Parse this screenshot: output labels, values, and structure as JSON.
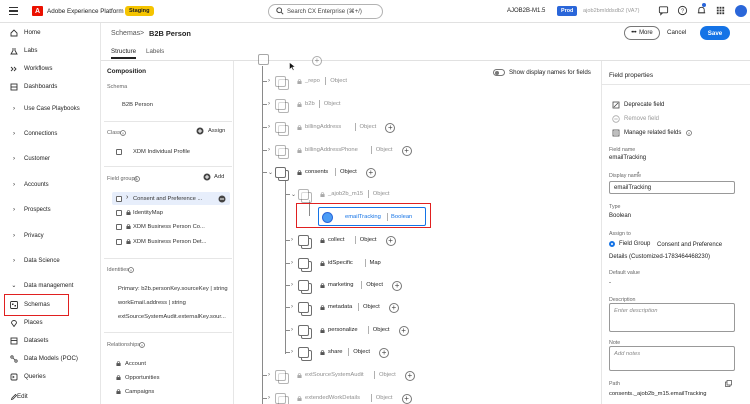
{
  "topbar": {
    "app_name": "Adobe Experience Platform",
    "sandbox_badge": "Staging",
    "search_placeholder": "Search CX Enterprise (⌘+/)",
    "org_name": "AJOB2B-M1.5",
    "env_badge": "Prod",
    "user_label": "ajob2bmlddsdb2 (VA7)"
  },
  "nav": {
    "items": [
      {
        "label": "Home",
        "icon": "home-icon"
      },
      {
        "label": "Labs",
        "icon": "labs-icon"
      },
      {
        "label": "Workflows",
        "icon": "workflows-icon"
      },
      {
        "label": "Dashboards",
        "icon": "dashboards-icon"
      },
      {
        "label": "Use Case Playbooks",
        "icon": "chevron-right-icon"
      },
      {
        "label": "Connections",
        "icon": "chevron-right-icon"
      },
      {
        "label": "Customer",
        "icon": "chevron-right-icon"
      },
      {
        "label": "Accounts",
        "icon": "chevron-right-icon"
      },
      {
        "label": "Prospects",
        "icon": "chevron-right-icon"
      },
      {
        "label": "Privacy",
        "icon": "chevron-right-icon"
      },
      {
        "label": "Data Science",
        "icon": "chevron-right-icon"
      },
      {
        "label": "Data management",
        "icon": "chevron-down-icon"
      },
      {
        "label": "Schemas",
        "icon": "schemas-icon"
      },
      {
        "label": "Places",
        "icon": "places-icon"
      },
      {
        "label": "Datasets",
        "icon": "datasets-icon"
      },
      {
        "label": "Data Models (POC)",
        "icon": "data-models-icon"
      },
      {
        "label": "Queries",
        "icon": "queries-icon"
      }
    ],
    "edit_label": "Edit"
  },
  "header": {
    "breadcrumb_root": "Schemas",
    "breadcrumb_sep": ">",
    "breadcrumb_current": "B2B Person",
    "tabs": [
      {
        "label": "Structure"
      },
      {
        "label": "Labels"
      }
    ],
    "more_label": "More",
    "cancel_label": "Cancel",
    "save_label": "Save"
  },
  "composition": {
    "title": "Composition",
    "schema_label": "Schema",
    "schema_value": "B2B Person",
    "class_label": "Class",
    "assign_label": "Assign",
    "class_value": "XDM Individual Profile",
    "field_groups_label": "Field groups",
    "add_label": "Add",
    "field_groups": [
      {
        "label": "Consent and Preference ..."
      },
      {
        "label": "IdentityMap"
      },
      {
        "label": "XDM Business Person Co..."
      },
      {
        "label": "XDM Business Person Det..."
      }
    ],
    "identities_label": "Identities",
    "identities": [
      {
        "label": "Primary: b2b.personKey.sourceKey | string"
      },
      {
        "label": "workEmail.address | string"
      },
      {
        "label": "extSourceSystemAudit.externalKey.sour..."
      }
    ],
    "relationships_label": "Relationships",
    "relationships": [
      {
        "label": "Account"
      },
      {
        "label": "Opportunities"
      },
      {
        "label": "Campaigns"
      }
    ]
  },
  "canvas": {
    "toggle_label": "Show display names for fields",
    "nodes": [
      {
        "name": "_repo",
        "type": "Object",
        "dim": true
      },
      {
        "name": "b2b",
        "type": "Object",
        "dim": true
      },
      {
        "name": "billingAddress",
        "type": "Object",
        "dim": true
      },
      {
        "name": "billingAddressPhone",
        "type": "Object",
        "dim": true
      },
      {
        "name": "consents",
        "type": "Object",
        "dim": false
      },
      {
        "name": "_ajob2b_m15",
        "type": "Object",
        "dim": true
      },
      {
        "name": "emailTracking",
        "type": "Boolean",
        "dim": false
      },
      {
        "name": "collect",
        "type": "Object",
        "dim": false
      },
      {
        "name": "idSpecific",
        "type": "Map",
        "dim": false
      },
      {
        "name": "marketing",
        "type": "Object",
        "dim": false
      },
      {
        "name": "metadata",
        "type": "Object",
        "dim": false
      },
      {
        "name": "personalize",
        "type": "Object",
        "dim": false
      },
      {
        "name": "share",
        "type": "Object",
        "dim": false
      },
      {
        "name": "extSourceSystemAudit",
        "type": "Object",
        "dim": true
      },
      {
        "name": "extendedWorkDetails",
        "type": "Object",
        "dim": true
      }
    ]
  },
  "field_properties": {
    "title": "Field properties",
    "deprecate_label": "Deprecate field",
    "remove_label": "Remove field",
    "manage_label": "Manage related fields",
    "field_name_label": "Field name",
    "field_name_value": "emailTracking",
    "display_name_label": "Display name",
    "display_name_value": "emailTracking",
    "type_label": "Type",
    "type_value": "Boolean",
    "assign_to_label": "Assign to",
    "assign_to_option": "Field Group",
    "assign_to_value": "Consent and Preference",
    "assign_to_details": "Details (Customized-1783464468230)",
    "default_value_label": "Default value",
    "default_value": "-",
    "description_label": "Description",
    "description_placeholder": "Enter description",
    "note_label": "Note",
    "note_placeholder": "Add notes",
    "path_label": "Path",
    "path_value": "consents._ajob2b_m15.emailTracking"
  },
  "colors": {
    "accent": "#1473e6",
    "highlight": "#e02020",
    "sandbox": "#f5c400"
  }
}
